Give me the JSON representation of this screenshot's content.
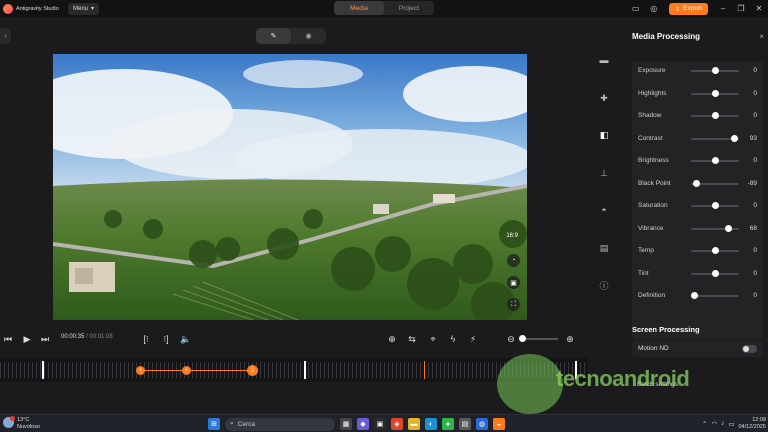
{
  "app": {
    "name": "Antigravity Studio",
    "menu_label": "Menu"
  },
  "header": {
    "tabs": [
      {
        "label": "Media",
        "active": true
      },
      {
        "label": "Project",
        "active": false
      }
    ],
    "export_label": "Export"
  },
  "player": {
    "aspect_ratio": "16:9",
    "current_time": "00:00:35",
    "separator": "/",
    "duration": "00:01:08"
  },
  "panel": {
    "title": "Media Processing",
    "sliders": [
      {
        "label": "Exposure",
        "value": "0",
        "level": 0.5
      },
      {
        "label": "Highlights",
        "value": "0",
        "level": 0.5
      },
      {
        "label": "Shadow",
        "value": "0",
        "level": 0.5
      },
      {
        "label": "Contrast",
        "value": "93",
        "level": 0.965
      },
      {
        "label": "Brightness",
        "value": "0",
        "level": 0.5
      },
      {
        "label": "Black Point",
        "value": "-89",
        "level": 0.055
      },
      {
        "label": "Saturation",
        "value": "0",
        "level": 0.5
      },
      {
        "label": "Vibrance",
        "value": "68",
        "level": 0.84
      },
      {
        "label": "Temp",
        "value": "0",
        "level": 0.5
      },
      {
        "label": "Tint",
        "value": "0",
        "level": 0.5
      },
      {
        "label": "Definition",
        "value": "0",
        "level": 0.0
      }
    ],
    "screen_processing_title": "Screen Processing",
    "motion_nd_label": "Motion ND",
    "motion_nd_enabled": false,
    "batch_label": "Batch settings"
  },
  "timeline": {
    "keyframe_count_label": "2"
  },
  "watermark": {
    "text": "tecnoandroid"
  },
  "taskbar": {
    "weather_temp": "13°C",
    "weather_desc": "Nuvoloso",
    "search_placeholder": "Cerca",
    "time": "12:08",
    "date": "04/12/2025"
  },
  "colors": {
    "accent": "#ff7a1a",
    "background": "#1b1b1d"
  }
}
